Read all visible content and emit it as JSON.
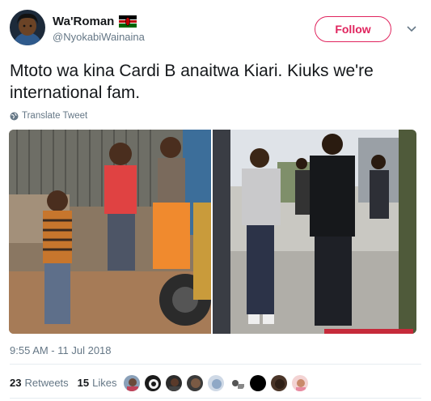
{
  "user": {
    "display_name": "Wa'Roman",
    "handle": "@NyokabiWainaina",
    "flag_icon": "kenya-flag-icon"
  },
  "follow_label": "Follow",
  "tweet": {
    "text": "Mtoto wa kina Cardi B anaitwa Kiari. Kiuks we're international fam.",
    "translate_label": "Translate Tweet"
  },
  "timestamp": "9:55 AM - 11 Jul 2018",
  "stats": {
    "retweets_count": "23",
    "retweets_label": "Retweets",
    "likes_count": "15",
    "likes_label": "Likes"
  },
  "colors": {
    "accent": "#e0245e",
    "muted": "#657786",
    "text": "#14171a",
    "divider": "#e6ecf0"
  }
}
